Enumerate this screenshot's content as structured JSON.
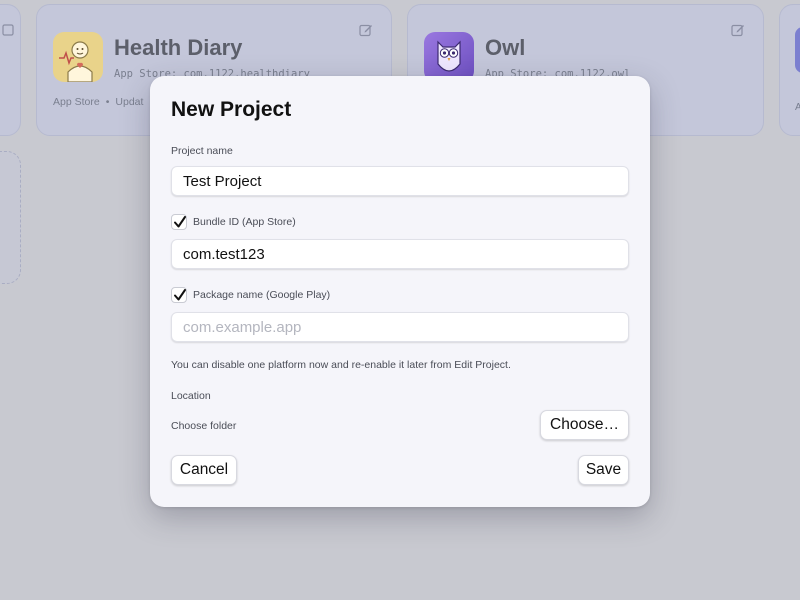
{
  "background": {
    "cards": [
      {
        "name": "Health Diary",
        "app_id": "App Store: com.1122.healthdiary",
        "meta_store": "App Store",
        "meta_extra": "Updat",
        "icon": "health-diary-app-icon"
      },
      {
        "name": "Owl",
        "app_id": "App Store: com.1122.owl",
        "icon": "owl-app-icon"
      }
    ],
    "right_card_text": "A",
    "edit_icon": "edit-icon"
  },
  "modal": {
    "title": "New Project",
    "project_name_label": "Project name",
    "project_name_value": "Test Project",
    "bundle_checkbox_label": "Bundle ID (App Store)",
    "bundle_checked": true,
    "bundle_value": "com.test123",
    "package_checkbox_label": "Package name (Google Play)",
    "package_checked": true,
    "package_value": "",
    "package_placeholder": "com.example.app",
    "hint": "You can disable one platform now and re-enable it later from Edit Project.",
    "location_label": "Location",
    "choose_folder_label": "Choose folder",
    "choose_button": "Choose…",
    "cancel_button": "Cancel",
    "save_button": "Save"
  },
  "colors": {
    "overlay": "#c8c9d0",
    "modal_bg": "#f5f5fa",
    "owl_icon": "#8e6fd6",
    "health_icon": "#f1d77f"
  }
}
